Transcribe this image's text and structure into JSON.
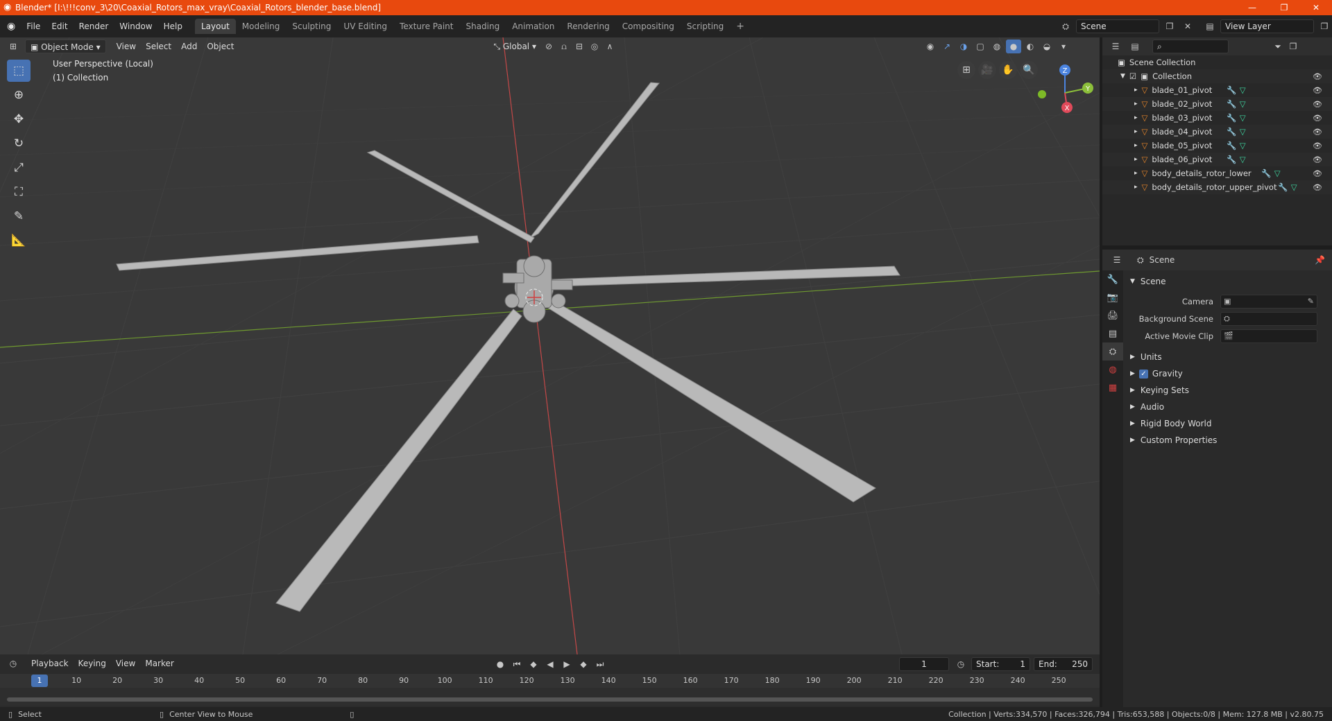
{
  "window": {
    "title": "Blender* [I:\\!!!conv_3\\20\\Coaxial_Rotors_max_vray\\Coaxial_Rotors_blender_base.blend]",
    "minimize": "—",
    "maximize": "❐",
    "close": "✕"
  },
  "menu": [
    "File",
    "Edit",
    "Render",
    "Window",
    "Help"
  ],
  "workspaces": [
    "Layout",
    "Modeling",
    "Sculpting",
    "UV Editing",
    "Texture Paint",
    "Shading",
    "Animation",
    "Rendering",
    "Compositing",
    "Scripting"
  ],
  "active_workspace": "Layout",
  "scene_name": "Scene",
  "view_layer": "View Layer",
  "viewport": {
    "mode": "Object Mode",
    "menus": [
      "View",
      "Select",
      "Add",
      "Object"
    ],
    "orientation": "Global",
    "info_line1": "User Perspective (Local)",
    "info_line2": "(1) Collection",
    "gizmo": {
      "z": "Z",
      "y": "Y",
      "x": "X"
    }
  },
  "outliner": {
    "root": "Scene Collection",
    "collection": "Collection",
    "items": [
      "blade_01_pivot",
      "blade_02_pivot",
      "blade_03_pivot",
      "blade_04_pivot",
      "blade_05_pivot",
      "blade_06_pivot",
      "body_details_rotor_lower",
      "body_details_rotor_upper_pivot"
    ]
  },
  "properties": {
    "header": "Scene",
    "panel": "Scene",
    "camera_label": "Camera",
    "background_scene_label": "Background Scene",
    "active_movie_clip_label": "Active Movie Clip",
    "sections": [
      "Units",
      "Gravity",
      "Keying Sets",
      "Audio",
      "Rigid Body World",
      "Custom Properties"
    ]
  },
  "timeline": {
    "menus": [
      "Playback",
      "Keying",
      "View",
      "Marker"
    ],
    "current_frame": "1",
    "start_label": "Start:",
    "start": "1",
    "end_label": "End:",
    "end": "250",
    "ticks": [
      "1",
      "10",
      "20",
      "30",
      "40",
      "50",
      "60",
      "70",
      "80",
      "90",
      "100",
      "110",
      "120",
      "130",
      "140",
      "150",
      "160",
      "170",
      "180",
      "190",
      "200",
      "210",
      "220",
      "230",
      "240",
      "250"
    ]
  },
  "statusbar": {
    "left": "Select",
    "middle": "Center View to Mouse",
    "right": "Collection | Verts:334,570 | Faces:326,794 | Tris:653,588 | Objects:0/8 | Mem: 127.8 MB | v2.80.75"
  },
  "colors": {
    "titlebar": "#e8490e",
    "accent": "#4772b3",
    "object_orange": "#e8862a",
    "modifier_blue": "#6aa0e8",
    "mesh_green": "#3ed6a0"
  }
}
